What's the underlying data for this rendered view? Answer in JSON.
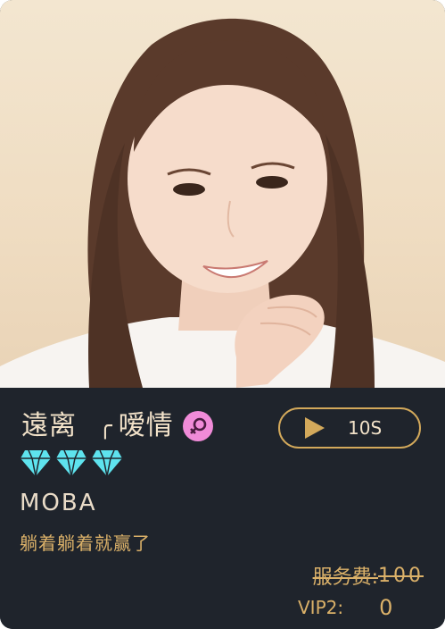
{
  "profile": {
    "photo_icon": "portrait-photo",
    "name_primary": "遠离",
    "name_separator": "╭",
    "name_secondary": "嗳情",
    "gender_icon": "female-icon",
    "gem_icon": "diamond-icon",
    "gem_count": 3,
    "game": "MOBA",
    "motto": "躺着躺着就赢了"
  },
  "voice_button": {
    "icon": "play-icon",
    "duration": "10S"
  },
  "pricing": {
    "fee_label": "服务费:",
    "fee_value": "100",
    "vip_label": "VIP2:",
    "vip_value": "0"
  },
  "colors": {
    "panel_bg": "#1f242c",
    "accent_gold": "#d3a95b",
    "text_cream": "#f2e2c9",
    "gender_pink": "#f08bd8",
    "gem_cyan": "#5ee3ee"
  }
}
